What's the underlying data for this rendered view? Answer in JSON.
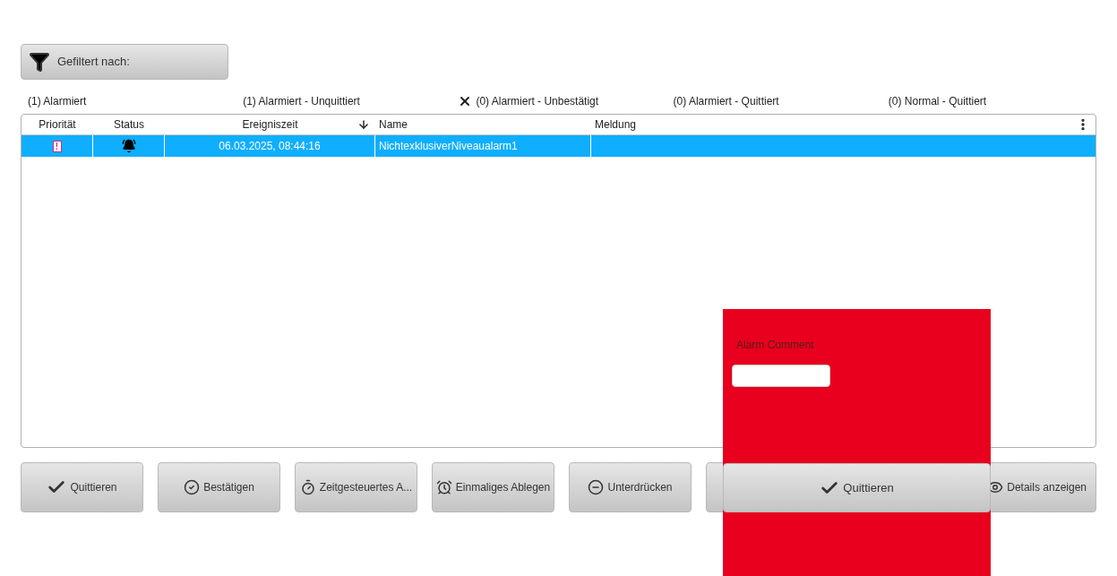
{
  "filter_button": {
    "label": "Gefiltert nach:"
  },
  "filters": [
    {
      "label": "(1) Alarmiert",
      "removable": false
    },
    {
      "label": "(1) Alarmiert - Unquittiert",
      "removable": false
    },
    {
      "label": "(0) Alarmiert - Unbestätigt",
      "removable": true
    },
    {
      "label": "(0) Alarmiert - Quittiert",
      "removable": false
    },
    {
      "label": "(0) Normal - Quittiert",
      "removable": false
    }
  ],
  "table": {
    "columns": [
      {
        "label": "Priorität",
        "sorted": false
      },
      {
        "label": "Status",
        "sorted": false
      },
      {
        "label": "Ereigniszeit",
        "sorted": true
      },
      {
        "label": "Name",
        "sorted": false
      },
      {
        "label": "Meldung",
        "sorted": false
      }
    ],
    "rows": [
      {
        "priority": "!",
        "time": "06.03.2025, 08:44:16",
        "name": "NichtexklusiverNiveaualarm1",
        "selected": true
      }
    ]
  },
  "buttons": [
    {
      "kind": "check",
      "label": "Quittieren"
    },
    {
      "kind": "check-circle",
      "label": "Bestätigen"
    },
    {
      "kind": "timer",
      "label": "Zeitgesteuertes A..."
    },
    {
      "kind": "alarm",
      "label": "Einmaliges Ablegen"
    },
    {
      "kind": "minus-circle",
      "label": "Unterdrücken"
    },
    {
      "kind": "eye",
      "label": "Details anzeigen"
    }
  ],
  "popup": {
    "label": "Alarm Comment",
    "button": "Quittieren"
  }
}
